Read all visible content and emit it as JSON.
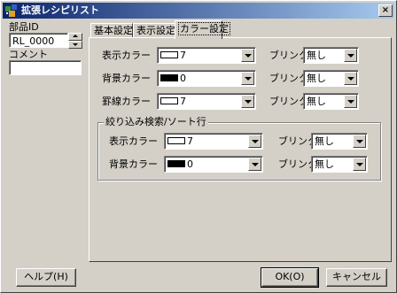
{
  "window": {
    "title": "拡張レシピリスト",
    "close_label": "×"
  },
  "left": {
    "part_id_label": "部品ID",
    "part_id_value": "RL_0000",
    "comment_label": "コメント",
    "comment_value": ""
  },
  "tabs": [
    {
      "label": "基本設定"
    },
    {
      "label": "表示設定"
    },
    {
      "label": "カラー設定",
      "active": true
    }
  ],
  "rows": [
    {
      "label": "表示カラー",
      "color_value": "7",
      "swatch_color": "#ffffff",
      "blink_label": "ブリンク",
      "blink_value": "無し"
    },
    {
      "label": "背景カラー",
      "color_value": "0",
      "swatch_color": "#000000",
      "blink_label": "ブリンク",
      "blink_value": "無し"
    },
    {
      "label": "罫線カラー",
      "color_value": "7",
      "swatch_color": "#ffffff",
      "blink_label": "ブリンク",
      "blink_value": "無し"
    }
  ],
  "group": {
    "title": "絞り込み検索/ソート行",
    "rows": [
      {
        "label": "表示カラー",
        "color_value": "7",
        "swatch_color": "#ffffff",
        "blink_label": "ブリンク",
        "blink_value": "無し"
      },
      {
        "label": "背景カラー",
        "color_value": "0",
        "swatch_color": "#000000",
        "blink_label": "ブリンク",
        "blink_value": "無し"
      }
    ]
  },
  "buttons": {
    "help": "ヘルプ(H)",
    "ok": "OK(O)",
    "cancel": "キャンセル"
  },
  "colors": {
    "face": "#d4d0c8",
    "titlebar_start": "#0a246a",
    "titlebar_end": "#a6caf0"
  }
}
